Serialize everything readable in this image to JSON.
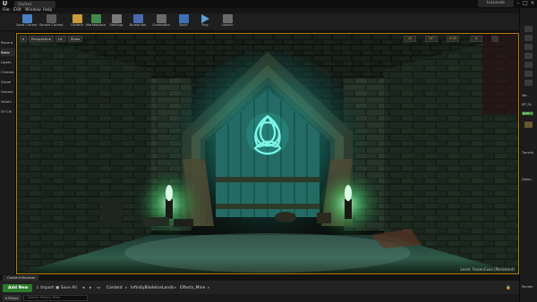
{
  "titlebar": {
    "logo": "U",
    "level_tab": "Vaulted",
    "project_name": "IceLands",
    "minimize": "–",
    "maximize": "□",
    "close": "×"
  },
  "menu": [
    "File",
    "Edit",
    "Window",
    "Help"
  ],
  "toolbar": [
    {
      "label": "Save Current",
      "color": "#4a7fc1"
    },
    {
      "label": "Source Control",
      "color": "#5a5a5a"
    },
    {
      "label": "Content",
      "color": "#c89a3a"
    },
    {
      "label": "Marketplace",
      "color": "#3f8a4a"
    },
    {
      "label": "Settings",
      "color": "#7a7a7a"
    },
    {
      "label": "Blueprints",
      "color": "#4a6ab0"
    },
    {
      "label": "Cinematics",
      "color": "#6a6a6a"
    },
    {
      "label": "Build",
      "color": "#3f6fb5"
    },
    {
      "label": "Play",
      "color": "#5a9fd8"
    },
    {
      "label": "Launch",
      "color": "#6a6a6a"
    }
  ],
  "left_panel": [
    "Recent",
    "Basic",
    "Lights",
    "Cinema",
    "Visual",
    "Geome",
    "Volum",
    "All Cla"
  ],
  "viewport": {
    "perspective": "Perspective",
    "lit": "Lit",
    "show": "Show",
    "grid_snap": "10",
    "rot_snap": "10°",
    "scale_snap": "0.25",
    "cam_speed": "4",
    "level_label": "Level:  FrozenCove (Persistent)"
  },
  "right_panel": {
    "items": [
      "Wo",
      "BP_Sk",
      "Add C",
      "Transfo",
      "Defau",
      "Render"
    ]
  },
  "content_browser": {
    "tab_label": "Content Browser",
    "add_new": "Add New",
    "import": "Import",
    "save_all": "Save All",
    "breadcrumbs": [
      "Content",
      "InfinityBladeIceLands",
      "Effects_Mine"
    ],
    "filters": "Filters",
    "search_placeholder": "Search Effects_Mine"
  },
  "colors": {
    "viewport_border": "#b57a00",
    "add_new_bg": "#2c7a2c",
    "rune_glow": "#3ff0e0",
    "torch_glow": "#7dff9a"
  }
}
